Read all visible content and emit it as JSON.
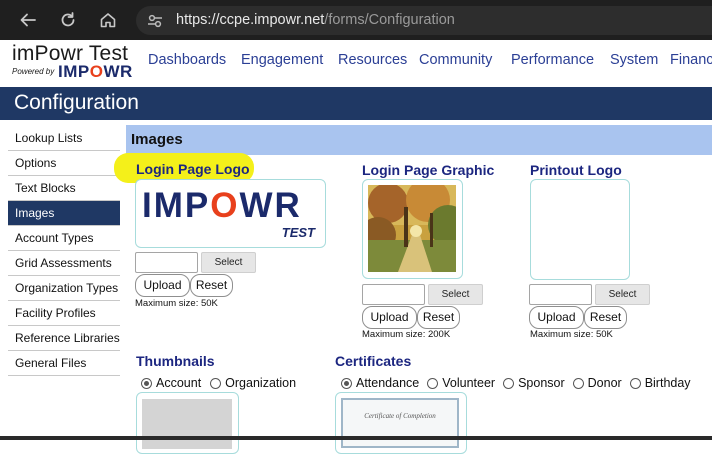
{
  "browser": {
    "url_host": "https://ccpe.impowr.net",
    "url_path": "/forms/Configuration",
    "icons": [
      "back-arrow-icon",
      "reload-icon",
      "home-icon",
      "site-info-icon"
    ]
  },
  "site": {
    "title": "imPowr Test",
    "powered_by": "Powered by",
    "brand": "IMPOWR",
    "nav": [
      "Dashboards",
      "Engagement",
      "Resources",
      "Community",
      "Performance",
      "System",
      "Financ"
    ]
  },
  "page": {
    "title": "Configuration"
  },
  "sidebar": {
    "items": [
      {
        "label": "Lookup Lists"
      },
      {
        "label": "Options"
      },
      {
        "label": "Text Blocks"
      },
      {
        "label": "Images"
      },
      {
        "label": "Account Types"
      },
      {
        "label": "Grid Assessments"
      },
      {
        "label": "Organization Types"
      },
      {
        "label": "Facility Profiles"
      },
      {
        "label": "Reference Libraries"
      },
      {
        "label": "General Files"
      }
    ],
    "active_index": 3
  },
  "main": {
    "section_title": "Images",
    "login_logo": {
      "title": "Login Page Logo",
      "logo_word": "IMPOWR",
      "logo_tag": "TEST",
      "select": "Select",
      "upload": "Upload",
      "reset": "Reset",
      "max": "Maximum size: 50K"
    },
    "login_graphic": {
      "title": "Login Page Graphic",
      "select": "Select",
      "upload": "Upload",
      "reset": "Reset",
      "max": "Maximum size: 200K"
    },
    "printout_logo": {
      "title": "Printout Logo",
      "select": "Select",
      "upload": "Upload",
      "reset": "Reset",
      "max": "Maximum size: 50K"
    },
    "thumbnails": {
      "title": "Thumbnails",
      "options": [
        "Account",
        "Organization"
      ],
      "selected": "Account"
    },
    "certificates": {
      "title": "Certificates",
      "options": [
        "Attendance",
        "Volunteer",
        "Sponsor",
        "Donor",
        "Birthday"
      ],
      "selected": "Attendance",
      "preview_text": "Certificate of Completion"
    }
  },
  "colors": {
    "chrome_bg": "#1f1f1f",
    "title_band": "#1f3864",
    "section_band": "#a9c4ef",
    "nav_link": "#2b3f95",
    "heading": "#1c2680",
    "brand_red": "#e8401c",
    "highlight": "#f4f01a"
  }
}
